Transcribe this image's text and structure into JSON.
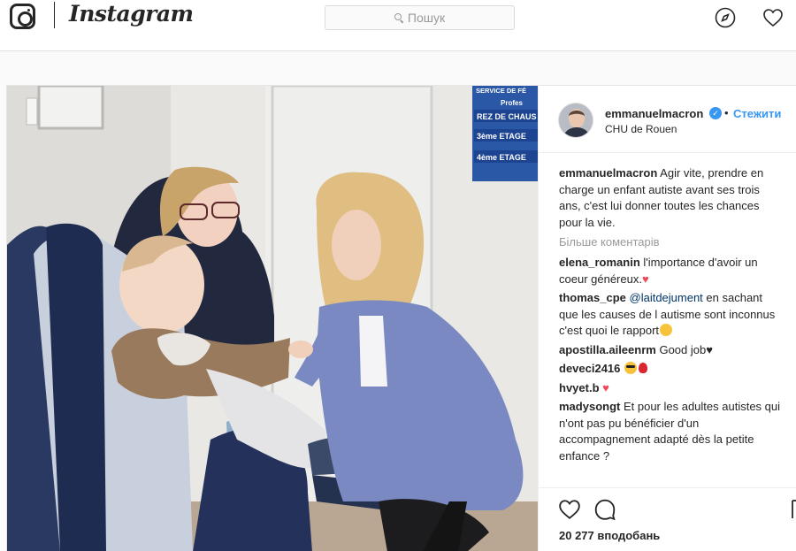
{
  "nav": {
    "brand": "Instagram",
    "search_placeholder": "Пошук",
    "icons": [
      "instagram-logo-icon",
      "search-icon",
      "compass-icon",
      "heart-icon"
    ]
  },
  "post": {
    "author": {
      "username": "emmanuelmacron",
      "verified": true,
      "follow_label": "Стежити",
      "location": "CHU de Rouen"
    },
    "caption": {
      "username": "emmanuelmacron",
      "text": "Agir vite, prendre en charge un enfant autiste avant ses trois ans, c'est lui donner toutes les chances pour la vie."
    },
    "more_comments_label": "Більше коментарів",
    "comments": [
      {
        "username": "elena_romanin",
        "text": "l'importance d'avoir un coeur généreux.",
        "emoji": "red-heart"
      },
      {
        "username": "thomas_cpe",
        "mention": "@laitdejument",
        "text": "en sachant que les causes de l autisme sont inconnus c'est quoi le rapport",
        "emoji": "sweat-smile"
      },
      {
        "username": "apostilla.aileenrm",
        "text": "Good job",
        "emoji": "black-heart"
      },
      {
        "username": "deveci2416",
        "text": "",
        "emoji": "sunglasses-rose"
      },
      {
        "username": "hvyet.b",
        "text": "",
        "emoji": "red-heart"
      },
      {
        "username": "madysongt",
        "text": "Et pour les adultes autistes qui n'ont pas pu bénéficier d'un accompagnement adapté dès la petite enfance ?",
        "emoji": ""
      }
    ],
    "likes_text": "20 277 вподобань",
    "photo_signs": [
      "SERVICE DE FÉ",
      "Profes",
      "REZ DE CHAUS",
      "3ème ETAGE",
      "4ème ETAGE"
    ],
    "colors": {
      "link_blue": "#3897f0",
      "heart_red": "#ed4956",
      "text": "#262626",
      "muted": "#999999"
    }
  }
}
